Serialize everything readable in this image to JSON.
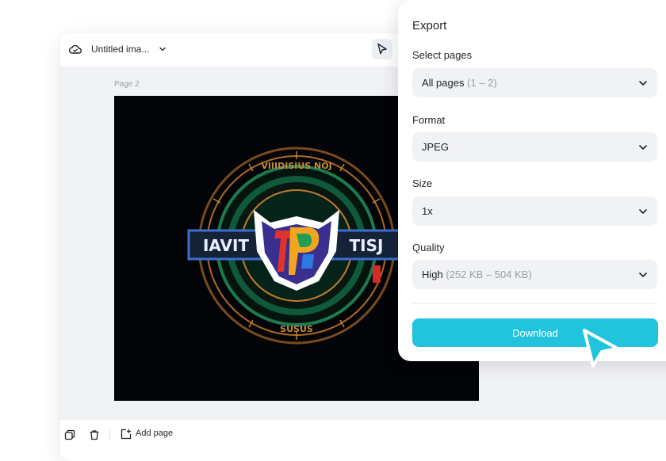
{
  "editor": {
    "doc_title": "Untitled ima...",
    "page_label": "Page 2",
    "icons": {
      "cloud": "cloud-icon",
      "dropdown": "chevron-down-icon",
      "pointer": "pointer-tool-icon"
    },
    "artwork": {
      "left_text": "IAVIT",
      "right_text": "TISJ",
      "ring_text_top": "VIIIDISIUS NOJ",
      "ring_text_bottom": "SUSUS"
    }
  },
  "bottom_bar": {
    "icons": {
      "duplicate": "duplicate-icon",
      "delete": "trash-icon",
      "add_page": "add-page-icon"
    },
    "add_page_label": "Add page"
  },
  "export_panel": {
    "title": "Export",
    "select_pages": {
      "label": "Select pages",
      "value": "All pages",
      "hint": "(1 – 2)"
    },
    "format": {
      "label": "Format",
      "value": "JPEG"
    },
    "size": {
      "label": "Size",
      "value": "1x"
    },
    "quality": {
      "label": "Quality",
      "value": "High",
      "hint": "(252 KB – 504 KB)"
    },
    "download_label": "Download"
  },
  "colors": {
    "accent": "#22c3dc",
    "field_bg": "#f1f2f5",
    "canvas_bg": "#f1f2f5",
    "text": "#1f2329",
    "muted": "#9aa0a8"
  }
}
